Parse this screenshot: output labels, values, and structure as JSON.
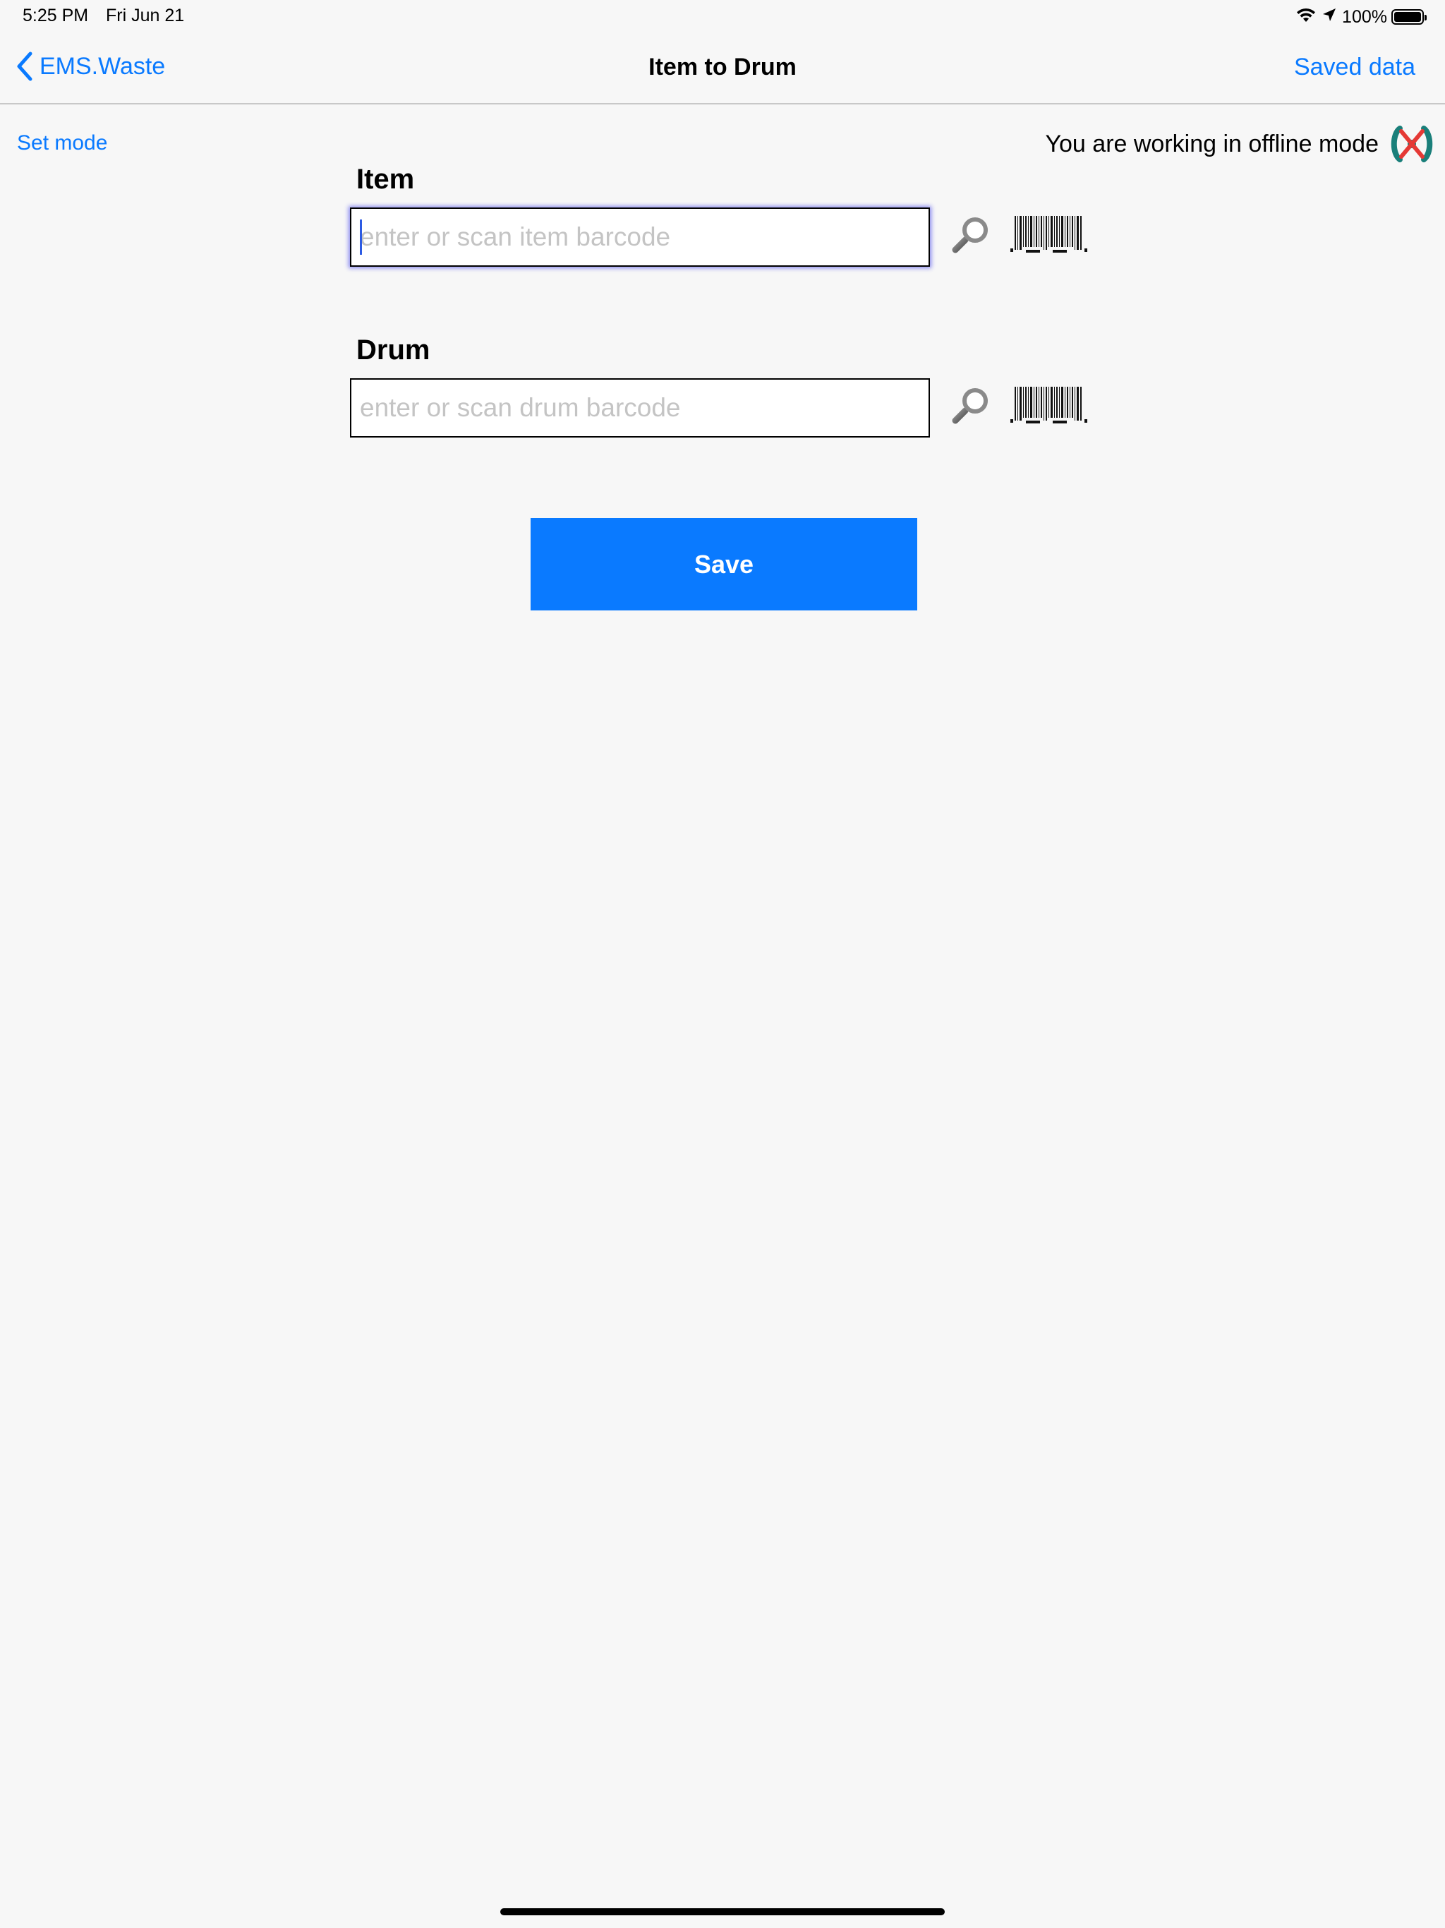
{
  "status_bar": {
    "time": "5:25 PM",
    "date": "Fri Jun 21",
    "battery": "100%",
    "icons": [
      "wifi-icon",
      "location-arrow-icon",
      "battery-icon"
    ]
  },
  "nav": {
    "back_label": "EMS.Waste",
    "title": "Item to Drum",
    "right_label": "Saved data"
  },
  "mode": {
    "set_mode_label": "Set mode",
    "offline_text": "You are working in offline mode",
    "offline_icon": "offline-sync-icon"
  },
  "item": {
    "label": "Item",
    "value": "",
    "placeholder": "enter or scan item barcode",
    "icons": [
      "search-icon",
      "barcode-icon"
    ]
  },
  "drum": {
    "label": "Drum",
    "value": "",
    "placeholder": "enter or scan drum barcode",
    "icons": [
      "search-icon",
      "barcode-icon"
    ]
  },
  "save_label": "Save",
  "colors": {
    "accent": "#0a7aff",
    "background": "#f7f7f7",
    "placeholder": "#c4c4c4",
    "offline_icon_teal": "#1a7f7a",
    "offline_icon_red": "#e53935"
  }
}
